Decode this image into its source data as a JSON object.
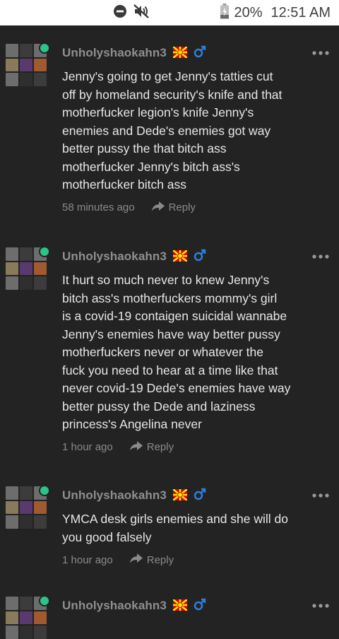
{
  "status_bar": {
    "icons": [
      "do-not-disturb-icon",
      "muted-icon",
      "battery-charging-icon"
    ],
    "battery": "20%",
    "time": "12:51 AM"
  },
  "comments": [
    {
      "username": "Unholyshaokahn3",
      "flag": "north-macedonia-flag-icon",
      "gender": "male-icon",
      "text_lines": [
        "Jenny's going to get Jenny's tatties cut",
        "off by homeland security's knife and that",
        "motherfucker legion's knife Jenny's",
        "enemies and Dede's enemies got way",
        "better pussy the that bitch ass",
        "motherfucker Jenny's bitch ass's",
        "motherfucker bitch ass"
      ],
      "time_ago": "58 minutes ago",
      "reply_label": "Reply"
    },
    {
      "username": "Unholyshaokahn3",
      "flag": "north-macedonia-flag-icon",
      "gender": "male-icon",
      "text_lines": [
        "It hurt so much never to knew Jenny's",
        "bitch ass's motherfuckers mommy's girl",
        "is a covid-19 contaigen suicidal wannabe",
        "Jenny's enemies have way better pussy",
        "motherfuckers  never or whatever the",
        "fuck you need to hear at a time like that",
        "never covid-19 Dede's enemies have way",
        "better pussy the Dede and laziness",
        "princess's Angelina never"
      ],
      "time_ago": "1 hour ago",
      "reply_label": "Reply"
    },
    {
      "username": "Unholyshaokahn3",
      "flag": "north-macedonia-flag-icon",
      "gender": "male-icon",
      "text_lines": [
        "YMCA desk girls enemies and she will do",
        "you good falsely"
      ],
      "time_ago": "1 hour ago",
      "reply_label": "Reply"
    },
    {
      "username": "Unholyshaokahn3",
      "flag": "north-macedonia-flag-icon",
      "gender": "male-icon",
      "text_lines": [],
      "time_ago": "",
      "reply_label": ""
    }
  ],
  "colors": {
    "background": "#232323",
    "status_bar": "#ffffff",
    "text": "#e6e6e6",
    "meta": "#8a8a8a",
    "online": "#2bc48a",
    "gender_male": "#2e7fe0",
    "flag_red": "#d20000",
    "flag_yellow": "#ffe600"
  }
}
